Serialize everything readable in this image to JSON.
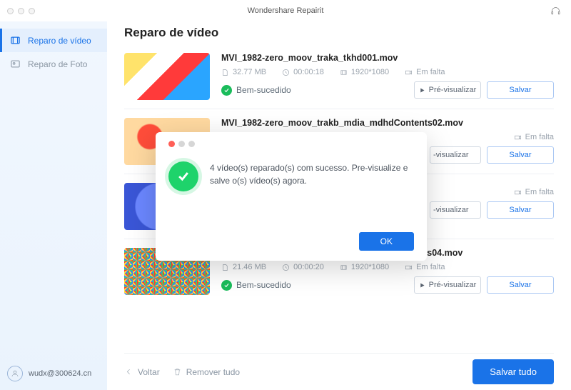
{
  "app_title": "Wondershare Repairit",
  "sidebar": {
    "items": [
      {
        "label": "Reparo de vídeo",
        "active": true
      },
      {
        "label": "Reparo de Foto",
        "active": false
      }
    ]
  },
  "user": {
    "email": "wudx@300624.cn"
  },
  "page_title": "Reparo de vídeo",
  "columns": {
    "size_icon": "file-icon",
    "time_icon": "clock-icon",
    "res_icon": "resolution-icon",
    "video_icon": "camera-icon"
  },
  "status_ok_label": "Bem-sucedido",
  "missing_label": "Em falta",
  "preview_label": "Pré-visualizar",
  "preview_label_short": "-visualizar",
  "save_label": "Salvar",
  "videos": [
    {
      "name": "MVI_1982-zero_moov_traka_tkhd001.mov",
      "size": "32.77 MB",
      "duration": "00:00:18",
      "resolution": "1920*1080",
      "thumb": "t1"
    },
    {
      "name": "MVI_1982-zero_moov_trakb_mdia_mdhdContents02.mov",
      "size": "",
      "duration": "",
      "resolution": "",
      "thumb": "t2"
    },
    {
      "name": "",
      "size": "",
      "duration": "",
      "resolution": "",
      "thumb": "t3"
    },
    {
      "name": "MVI_1982-zero_moov_trakv_mdia_mdhdContents04.mov",
      "size": "21.46 MB",
      "duration": "00:00:20",
      "resolution": "1920*1080",
      "thumb": "t4"
    }
  ],
  "footer": {
    "back": "Voltar",
    "remove_all": "Remover tudo",
    "save_all": "Salvar tudo"
  },
  "modal": {
    "message": "4 vídeo(s) reparado(s) com sucesso. Pre-visualize e salve o(s) vídeo(s) agora.",
    "ok": "OK"
  }
}
